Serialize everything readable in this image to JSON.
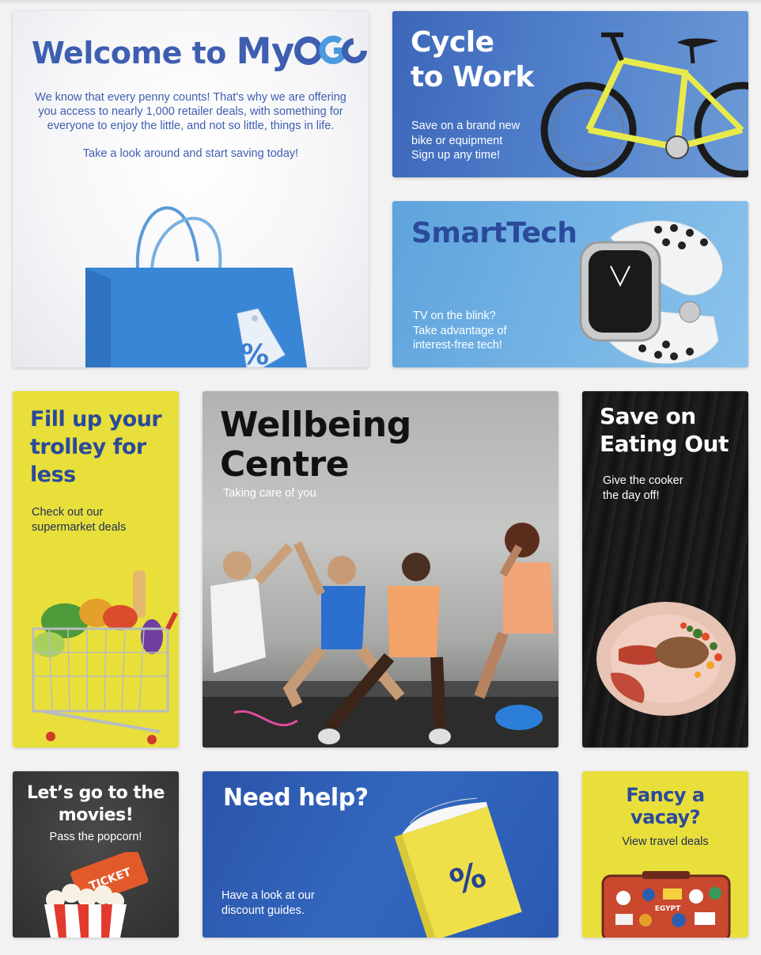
{
  "colors": {
    "brand_blue": "#3e5eb0",
    "accent_yellow": "#e9df3a",
    "background": "#f3f2f2"
  },
  "welcome": {
    "title_prefix": "Welcome to",
    "logo_my": "My",
    "paragraph1": "We know that every penny counts! That's why we are offering you access to nearly 1,000 retailer deals, with something for everyone to enjoy the little, and not so little, things in life.",
    "paragraph2": "Take a look around and start saving today!",
    "tag_symbol": "%"
  },
  "cycle": {
    "title_line1": "Cycle",
    "title_line2": "to Work",
    "text": [
      "Save on a brand new",
      "bike or equipment",
      "Sign up any time!"
    ]
  },
  "smarttech": {
    "title": "SmartTech",
    "text": [
      "TV on the blink?",
      "Take advantage of",
      "interest-free tech!"
    ]
  },
  "trolley": {
    "title": [
      "Fill up your",
      "trolley for",
      "less"
    ],
    "text": [
      "Check out our",
      "supermarket deals"
    ]
  },
  "wellbeing": {
    "title": [
      "Wellbeing",
      "Centre"
    ],
    "text": "Taking care of you"
  },
  "eatingout": {
    "title": [
      "Save on",
      "Eating Out"
    ],
    "text": [
      "Give the cooker",
      "the day off!"
    ]
  },
  "movies": {
    "title": [
      "Let’s go to the",
      "movies!"
    ],
    "text": "Pass the popcorn!",
    "ticket_text": "TICKET"
  },
  "help": {
    "title": "Need help?",
    "text": [
      "Have a look at our",
      "discount guides."
    ],
    "book_symbol": "%"
  },
  "vacay": {
    "title": [
      "Fancy a",
      "vacay?"
    ],
    "text": "View travel deals",
    "sticker_text": "EGYPT"
  }
}
